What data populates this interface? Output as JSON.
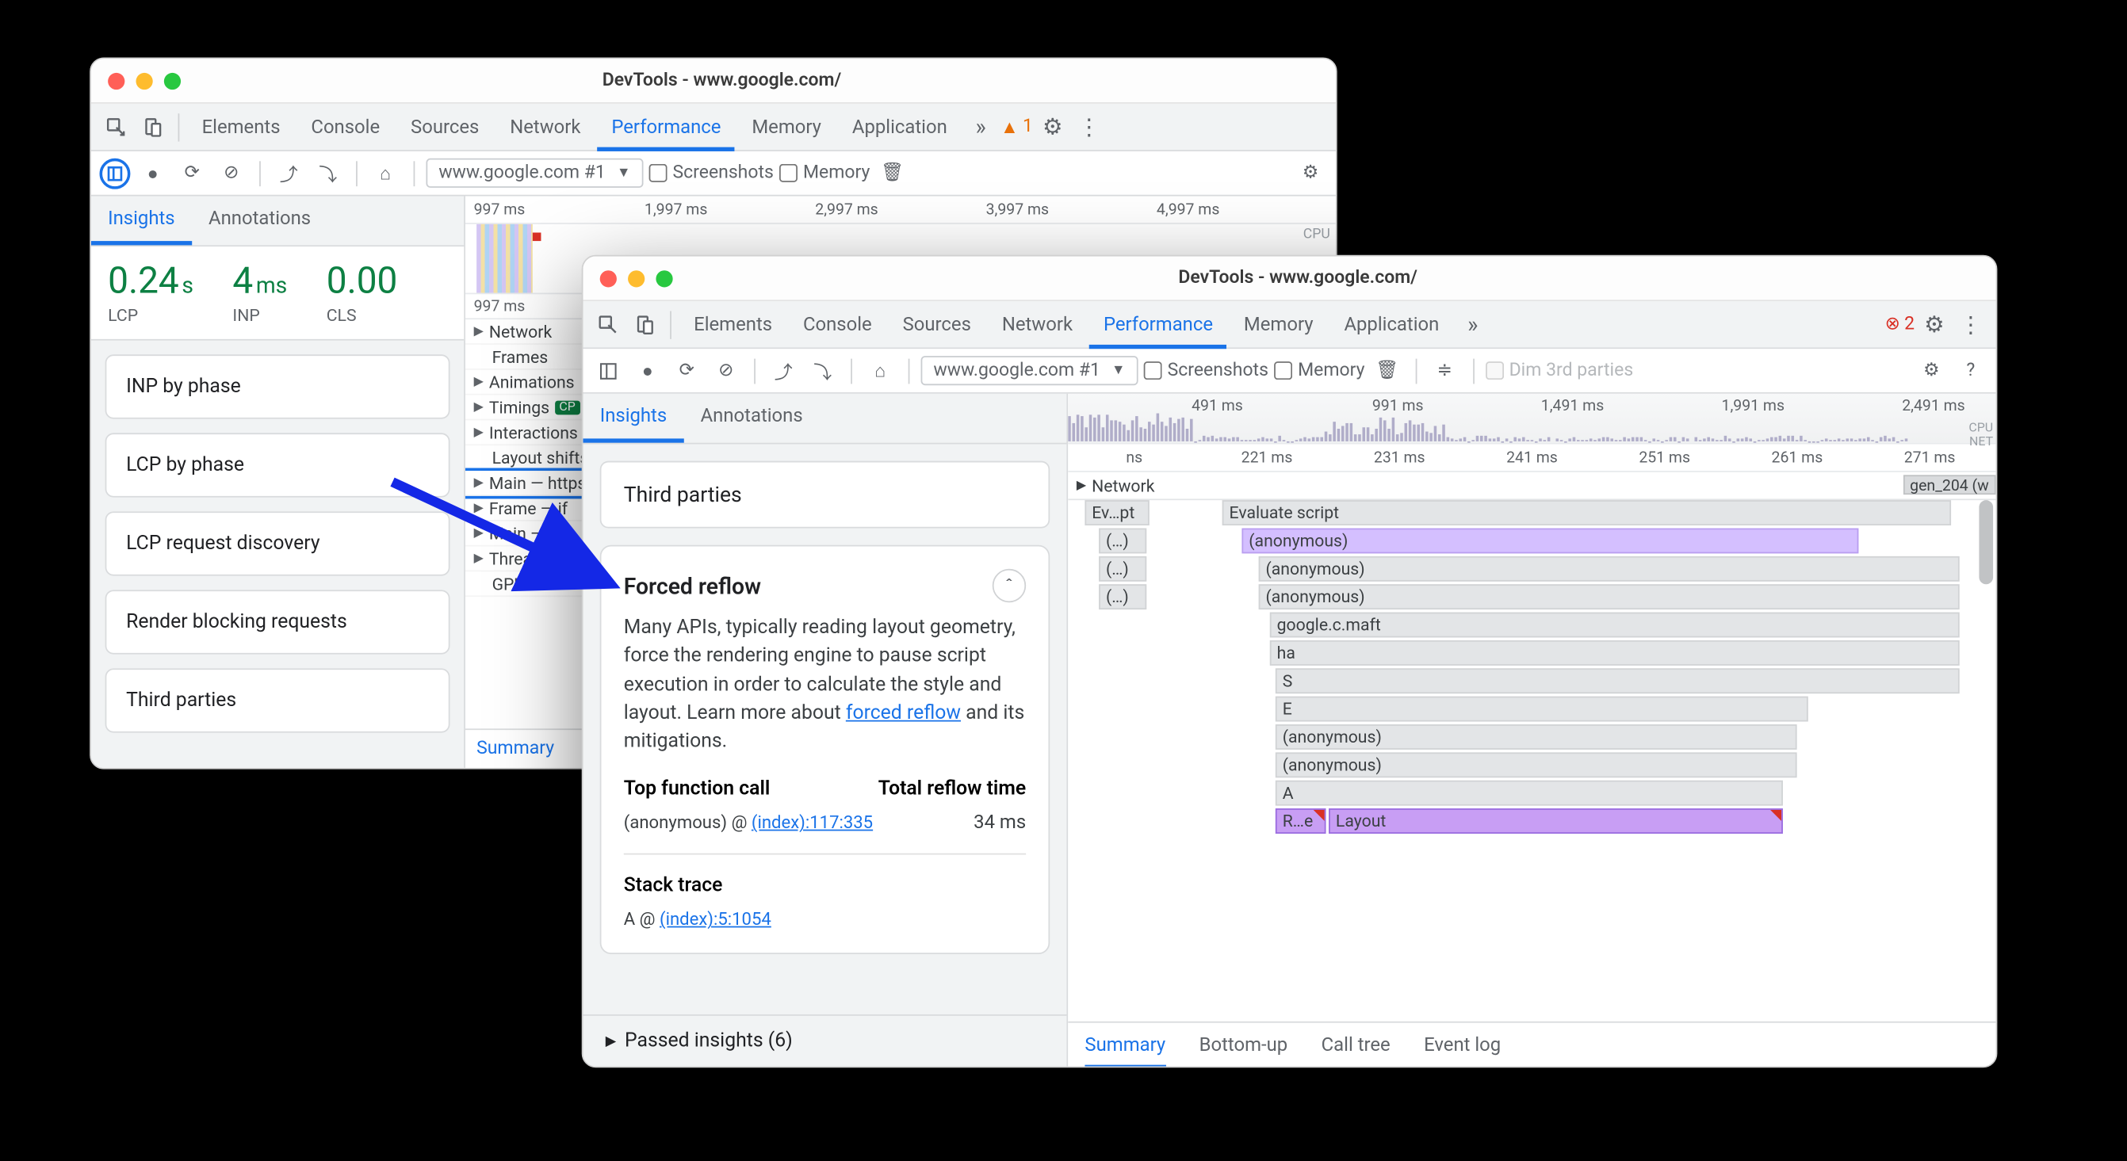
{
  "window_title": "DevTools - www.google.com/",
  "tabs": [
    "Elements",
    "Console",
    "Sources",
    "Network",
    "Performance",
    "Memory",
    "Application"
  ],
  "tabs_overflow": "»",
  "active_tab": "Performance",
  "warning_count": 1,
  "error_count": 2,
  "toolbar": {
    "context": "www.google.com #1",
    "cb_screenshots": "Screenshots",
    "cb_memory": "Memory",
    "dim_label": "Dim 3rd parties"
  },
  "sidebar": {
    "tab_insights": "Insights",
    "tab_annotations": "Annotations"
  },
  "win1": {
    "metrics": [
      {
        "value": "0.24",
        "unit": "s",
        "label": "LCP"
      },
      {
        "value": "4",
        "unit": "ms",
        "label": "INP"
      },
      {
        "value": "0.00",
        "unit": "",
        "label": "CLS"
      }
    ],
    "cards": [
      "INP by phase",
      "LCP by phase",
      "LCP request discovery",
      "Render blocking requests",
      "Third parties"
    ],
    "ruler": [
      "997 ms",
      "1,997 ms",
      "2,997 ms",
      "3,997 ms",
      "4,997 ms"
    ],
    "ruler2": "997 ms",
    "cpu_label": "CPU",
    "tracks": [
      "Network",
      "Frames",
      "Animations",
      "Timings",
      "Interactions",
      "Layout shifts",
      "Main — https",
      "Frame — if",
      "Main — abo",
      "Thread poo",
      "GPU"
    ],
    "timings_badge": "CP",
    "summary": "Summary"
  },
  "win2": {
    "third_parties": "Third parties",
    "forced_reflow": {
      "title": "Forced reflow",
      "desc_a": "Many APIs, typically reading layout geometry, force the rendering engine to pause script execution in order to calculate the style and layout. Learn more about ",
      "link": "forced reflow",
      "desc_b": " and its mitigations.",
      "col_a": "Top function call",
      "col_b": "Total reflow time",
      "fn": "(anonymous) @ ",
      "fn_loc": "(index):117:335",
      "rt": "34 ms",
      "stack_label": "Stack trace",
      "stack_fn": "A @ ",
      "stack_loc": "(index):5:1054"
    },
    "passed": "Passed insights (6)",
    "overview_ticks": [
      "491 ms",
      "991 ms",
      "1,491 ms",
      "1,991 ms",
      "2,491 ms"
    ],
    "cpu_label": "CPU",
    "net_label": "NET",
    "timeline_ruler": [
      "ns",
      "221 ms",
      "231 ms",
      "241 ms",
      "251 ms",
      "261 ms",
      "271 ms"
    ],
    "network_track": "Network",
    "network_evt": "gen_204 (w",
    "flame": {
      "c0": "Ev…pt",
      "c1": "(…)",
      "c2": "(…)",
      "c3": "(…)",
      "evsc": "Evaluate script",
      "anon": "(anonymous)",
      "gc": "google.c.maft",
      "ha": "ha",
      "S": "S",
      "E": "E",
      "A": "A",
      "Re": "R…e",
      "Layout": "Layout"
    },
    "bottom": [
      "Summary",
      "Bottom-up",
      "Call tree",
      "Event log"
    ]
  }
}
